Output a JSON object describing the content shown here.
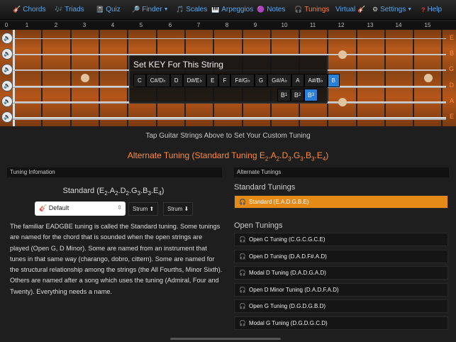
{
  "nav": [
    {
      "label": "Chords",
      "icon": "guitar-icon",
      "glyph": "🎸",
      "active": false
    },
    {
      "label": "Triads",
      "icon": "music-note-icon",
      "glyph": "🎶",
      "active": false
    },
    {
      "label": "Quiz",
      "icon": "quiz-icon",
      "glyph": "📓",
      "active": false
    },
    {
      "label": "Finder",
      "icon": "search-icon",
      "glyph": "🔎",
      "active": false,
      "dropdown": true
    },
    {
      "label": "Scales",
      "icon": "scales-icon",
      "glyph": "🎵",
      "active": false
    },
    {
      "label": "Arpeggios",
      "icon": "piano-icon",
      "glyph": "🎹",
      "active": false
    },
    {
      "label": "Notes",
      "icon": "notes-icon",
      "glyph": "🟣",
      "active": false
    },
    {
      "label": "Tunings",
      "icon": "headphones-icon",
      "glyph": "🎧",
      "active": true
    },
    {
      "label": "Virtual",
      "icon": "guitar-icon",
      "glyph": "🎸",
      "active": false
    },
    {
      "label": "Settings",
      "icon": "gear-icon",
      "glyph": "⚙",
      "active": false,
      "dropdown": true
    },
    {
      "label": "Help",
      "icon": "help-icon",
      "glyph": "?",
      "active": false
    }
  ],
  "fret_numbers": [
    "0",
    "1",
    "2",
    "3",
    "4",
    "5",
    "6",
    "7",
    "8",
    "9",
    "10",
    "11",
    "12",
    "13",
    "14",
    "15"
  ],
  "string_names": [
    "E",
    "B",
    "G",
    "D",
    "A",
    "E"
  ],
  "popup": {
    "title": "Set KEY For This String",
    "keys": [
      "C",
      "C#/D♭",
      "D",
      "D#/E♭",
      "E",
      "F",
      "F#/G♭",
      "G",
      "G#/A♭",
      "A",
      "A#/B♭",
      "B"
    ],
    "selected_key": "B",
    "octaves": [
      "B1",
      "B2",
      "B3"
    ],
    "selected_octave": "B3"
  },
  "tap_caption": "Tap Guitar Strings Above to Set Your Custom Tuning",
  "alternate_title": "Alternate Tuning (Standard Tuning E2.A2.D3.G3.B3.E4)",
  "left_panel": {
    "header": "Tuning Infomation",
    "standard_name": "Standard (E2.A2.D2.G3.B3.E4)",
    "select_value": "Default",
    "strum_up": "Strum ⬆",
    "strum_down": "Strum ⬇",
    "description": "The familiar EADGBE tuning is called the Standard tuning. Some tunings are named for the chord that is sounded when the open strings are played (Open G, D Minor). Some are named from an instrument that tunes in that same way (charango, dobro, cittern). Some are named for the structural relationship among the strings (the All Fourths, Minor Sixth). Others are named after a song which uses the tuning (Admiral, Four and Twenty). Everything needs a name."
  },
  "right_panel": {
    "header": "Alternate Tunings",
    "standard_section": "Standard Tunings",
    "standard_items": [
      "Standard (E.A.D.G.B.E)"
    ],
    "open_section": "Open Tunings",
    "open_items": [
      "Open C Tuning (C.G.C.G.C.E)",
      "Open D Tuning (D.A.D.F#.A.D)",
      "Modal D Tuning (D.A.D.G.A.D)",
      "Open D Minor Tuning (D.A.D.F.A.D)",
      "Open G Tuning (D.G.D.G.B.D)",
      "Modal G Tuning (D.G.D.G.C.D)"
    ]
  },
  "colors": {
    "accent": "#ff8b3c",
    "link": "#5aa8ef",
    "selected": "#2a7fd6",
    "selected_row": "#e58a16"
  }
}
